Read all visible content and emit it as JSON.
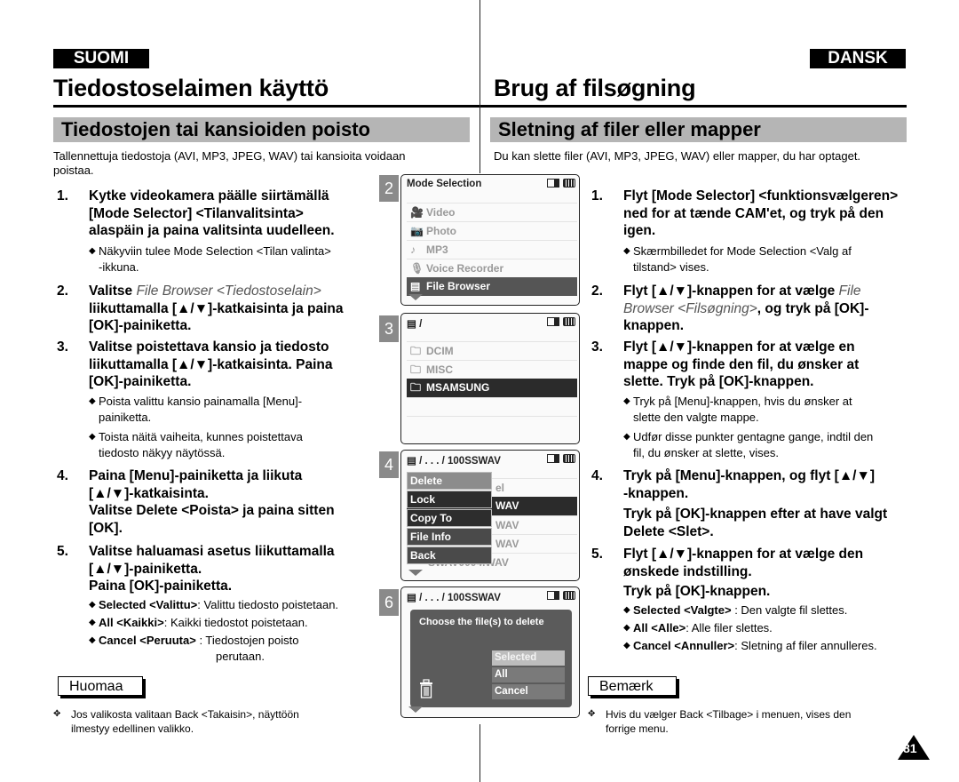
{
  "left": {
    "lang": "SUOMI",
    "title": "Tiedostoselaimen käyttö",
    "section": "Tiedostojen tai kansioiden poisto",
    "intro": "Tallennettuja tiedostoja (AVI, MP3, JPEG, WAV) tai kansioita voidaan poistaa.",
    "steps": [
      {
        "num": "1.",
        "lines": [
          "Kytke videokamera päälle siirtämällä",
          "[Mode Selector] <Tilanvalitsinta>",
          "alaspäin ja paina valitsinta uudelleen."
        ]
      },
      {
        "num": "2.",
        "line1_pre": "Valitse ",
        "line1_it": "File Browser <Tiedostoselain>",
        "lines": [
          "liikuttamalla [▲/▼]-katkaisinta ja paina",
          "[OK]-painiketta."
        ]
      },
      {
        "num": "3.",
        "lines": [
          "Valitse poistettava kansio ja tiedosto",
          "liikuttamalla [▲/▼]-katkaisinta. Paina",
          "[OK]-painiketta."
        ]
      },
      {
        "num": "4.",
        "lines": [
          "Paina [Menu]-painiketta ja liikuta",
          "[▲/▼]-katkaisinta.",
          "Valitse Delete <Poista> ja paina sitten",
          "[OK]."
        ]
      },
      {
        "num": "5.",
        "lines": [
          "Valitse haluamasi asetus liikuttamalla",
          "[▲/▼]-painiketta.",
          "Paina [OK]-painiketta."
        ]
      }
    ],
    "bullets": {
      "s1": [
        "Näkyviin tulee Mode Selection <Tilan valinta>",
        "-ikkuna."
      ],
      "s3a": [
        "Poista valittu kansio painamalla [Menu]-",
        "painiketta."
      ],
      "s3b": [
        "Toista näitä vaiheita, kunnes poistettava",
        "tiedosto näkyy näytössä."
      ],
      "s5": [
        {
          "b": "Selected <Valittu>",
          "t": ": Valittu tiedosto poistetaan."
        },
        {
          "b": "All <Kaikki>",
          "t": ": Kaikki tiedostot poistetaan."
        },
        {
          "b": "Cancel <Peruuta>",
          "t": " : Tiedostojen poisto",
          "t2": "perutaan."
        }
      ]
    },
    "note_label": "Huomaa",
    "note": [
      "Jos valikosta valitaan Back <Takaisin>, näyttöön",
      "ilmestyy edellinen valikko."
    ]
  },
  "right": {
    "lang": "DANSK",
    "title": "Brug af filsøgning",
    "section": "Sletning af filer eller mapper",
    "intro": "Du kan slette filer (AVI, MP3, JPEG, WAV) eller mapper, du har optaget.",
    "steps": [
      {
        "num": "1.",
        "lines": [
          "Flyt [Mode Selector] <funktionsvælgeren>",
          "ned for at tænde CAM'et, og tryk på den",
          "igen."
        ]
      },
      {
        "num": "2.",
        "line1": "Flyt [▲/▼]-knappen for at vælge ",
        "line1_it": "File",
        "line2_it": "Browser <Filsøgning>",
        "line2": ", og tryk på [OK]-",
        "line3": "knappen."
      },
      {
        "num": "3.",
        "lines": [
          "Flyt [▲/▼]-knappen for at vælge en",
          "mappe og finde den fil, du ønsker at",
          "slette. Tryk på [OK]-knappen."
        ]
      },
      {
        "num": "4.",
        "lines": [
          "Tryk på [Menu]-knappen, og flyt [▲/▼]",
          "-knappen.",
          "Tryk på [OK]-knappen efter at have valgt",
          "Delete <Slet>."
        ]
      },
      {
        "num": "5.",
        "lines": [
          "Flyt [▲/▼]-knappen for at vælge den",
          "ønskede indstilling.",
          "Tryk på [OK]-knappen."
        ]
      }
    ],
    "bullets": {
      "s1": [
        "Skærmbilledet for Mode Selection <Valg af",
        "tilstand> vises."
      ],
      "s3a": [
        "Tryk på [Menu]-knappen, hvis du ønsker at",
        "slette den valgte mappe."
      ],
      "s3b": [
        "Udfør disse punkter gentagne gange, indtil den",
        "fil, du ønsker at slette, vises."
      ],
      "s5": [
        {
          "b": "Selected <Valgte>",
          "t": " : Den valgte fil slettes."
        },
        {
          "b": "All <Alle>",
          "t": ": Alle filer slettes."
        },
        {
          "b": "Cancel <Annuller>",
          "t": ": Sletning af filer annulleres."
        }
      ]
    },
    "note_label": "Bemærk",
    "note": [
      "Hvis du vælger Back <Tilbage> i menuen, vises den",
      "forrige menu."
    ]
  },
  "screens": {
    "s2": {
      "badge": "2",
      "title": "Mode Selection",
      "items": [
        "Video",
        "Photo",
        "MP3",
        "Voice Recorder",
        "File Browser"
      ],
      "selected": 4
    },
    "s3": {
      "badge": "3",
      "path": "/",
      "items": [
        "DCIM",
        "MISC",
        "MSAMSUNG"
      ],
      "selected": 2
    },
    "s4": {
      "badge": "4",
      "path": "/ . . . / 100SSWAV",
      "menu": [
        "Delete",
        "Lock",
        "Copy To",
        "File Info",
        "Back"
      ],
      "bg_rows": [
        "el",
        "WAV",
        "WAV",
        "WAV",
        "SWAV0004.WAV"
      ]
    },
    "s6": {
      "badge": "6",
      "path": "/ . . . / 100SSWAV",
      "message": "Choose the file(s) to delete",
      "options": [
        "Selected",
        "All",
        "Cancel"
      ]
    }
  },
  "page_number": "81"
}
